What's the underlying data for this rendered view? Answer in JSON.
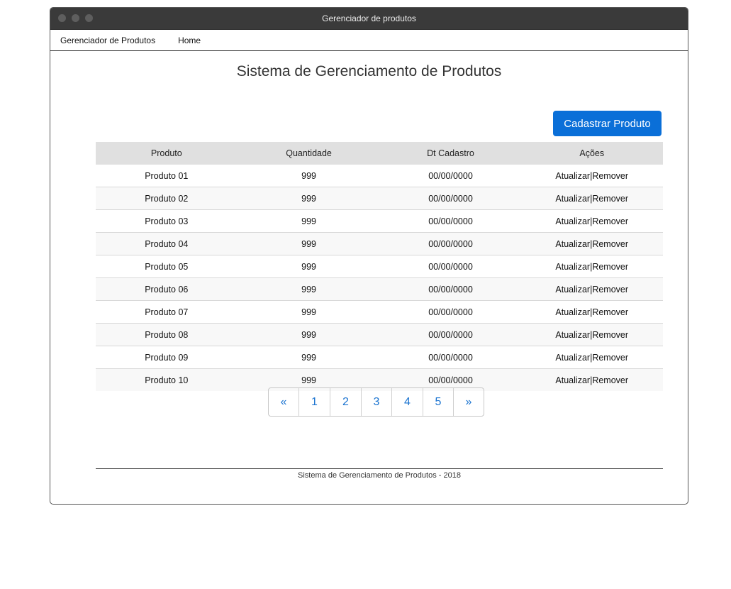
{
  "window": {
    "title": "Gerenciador de produtos"
  },
  "menu": {
    "items": [
      {
        "label": "Gerenciador de Produtos"
      },
      {
        "label": "Home"
      }
    ]
  },
  "page": {
    "title": "Sistema de Gerenciamento de Produtos"
  },
  "actions": {
    "add_label": "Cadastrar Produto"
  },
  "table": {
    "headers": [
      "Produto",
      "Quantidade",
      "Dt Cadastro",
      "Ações"
    ],
    "rows": [
      [
        "Produto 01",
        "999",
        "00/00/0000"
      ],
      [
        "Produto 02",
        "999",
        "00/00/0000"
      ],
      [
        "Produto 03",
        "999",
        "00/00/0000"
      ],
      [
        "Produto 04",
        "999",
        "00/00/0000"
      ],
      [
        "Produto 05",
        "999",
        "00/00/0000"
      ],
      [
        "Produto 06",
        "999",
        "00/00/0000"
      ],
      [
        "Produto 07",
        "999",
        "00/00/0000"
      ],
      [
        "Produto 08",
        "999",
        "00/00/0000"
      ],
      [
        "Produto 09",
        "999",
        "00/00/0000"
      ],
      [
        "Produto 10",
        "999",
        "00/00/0000"
      ]
    ],
    "row_actions": {
      "update": "Atualizar",
      "separator": "|",
      "remove": "Remover"
    }
  },
  "pagination": {
    "prev": "«",
    "pages": [
      "1",
      "2",
      "3",
      "4",
      "5"
    ],
    "next": "»"
  },
  "footer": {
    "text": "Sistema de Gerenciamento de Produtos -  2018"
  },
  "colors": {
    "primary": "#0a6fd8",
    "link": "#1a73d0",
    "titlebar": "#3a3a3a",
    "table_header": "#e0e0e0"
  }
}
